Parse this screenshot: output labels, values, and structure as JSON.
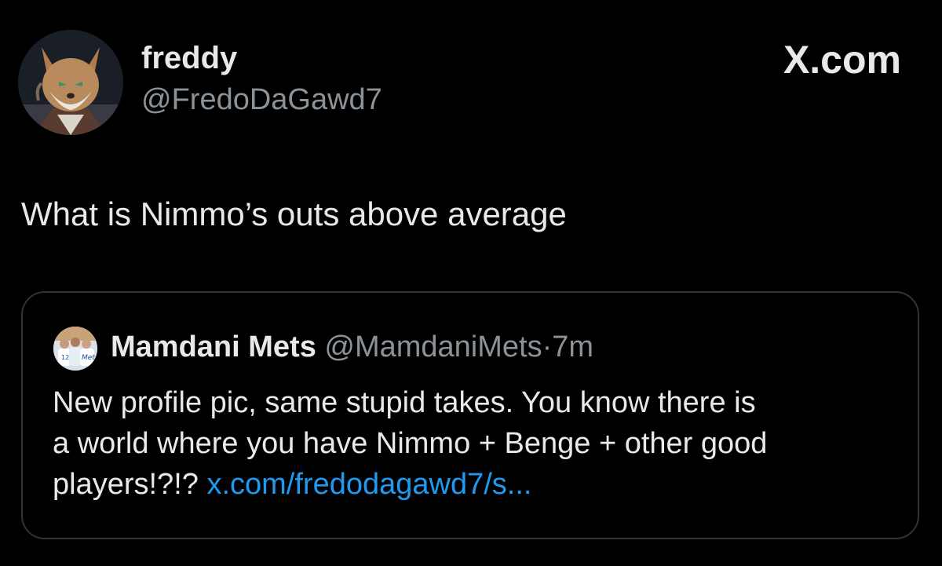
{
  "author": {
    "display_name": "freddy",
    "handle": "@FredoDaGawd7",
    "avatar_icon": "fox-avatar"
  },
  "brand": {
    "label": "X.com"
  },
  "tweet": {
    "text": "What is Nimmo’s outs above average"
  },
  "quoted_tweet": {
    "display_name": "Mamdani Mets",
    "handle": "@MamdaniMets",
    "separator": "·",
    "time": "7m",
    "avatar_icon": "mets-fans-avatar",
    "text_lines": [
      "New profile pic, same stupid takes. You know there is",
      "a world where you have Nimmo + Benge + other good",
      "players!?!?"
    ],
    "link": "x.com/fredodagawd7/s..."
  },
  "colors": {
    "background": "#000000",
    "primary_text": "#e7e9ea",
    "secondary_text": "#8b9298",
    "link": "#1d9bf0",
    "card_border": "#2f3336"
  }
}
